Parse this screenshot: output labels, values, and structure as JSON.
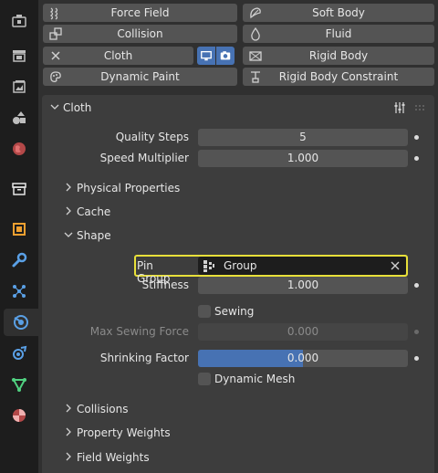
{
  "tabs": [
    {
      "name": "tool-icon",
      "color": "#bdbdbd"
    },
    {
      "name": "render-icon",
      "color": "#bdbdbd"
    },
    {
      "name": "output-icon",
      "color": "#bdbdbd"
    },
    {
      "name": "view-layer-icon",
      "color": "#bdbdbd"
    },
    {
      "name": "scene-icon",
      "color": "#bdbdbd"
    },
    {
      "name": "world-icon",
      "color": "#e06666"
    },
    {
      "name": "collection-icon",
      "color": "#e6e6e6"
    },
    {
      "name": "object-icon",
      "color": "#f0a030"
    },
    {
      "name": "modifier-icon",
      "color": "#5aa0e6"
    },
    {
      "name": "particles-icon",
      "color": "#5aa0e6"
    },
    {
      "name": "physics-icon",
      "color": "#5aa0e6",
      "active": true
    },
    {
      "name": "constraints-icon",
      "color": "#5aa0e6"
    },
    {
      "name": "data-icon",
      "color": "#50d080"
    },
    {
      "name": "material-icon",
      "color": "#e06666"
    }
  ],
  "physics_buttons": {
    "force_field": "Force Field",
    "soft_body": "Soft Body",
    "collision": "Collision",
    "fluid": "Fluid",
    "cloth": "Cloth",
    "rigid_body": "Rigid Body",
    "dynamic_paint": "Dynamic Paint",
    "rigid_body_constraint": "Rigid Body Constraint"
  },
  "cloth_panel": {
    "title": "Cloth",
    "quality_steps": {
      "label": "Quality Steps",
      "value": "5"
    },
    "speed_multiplier": {
      "label": "Speed Multiplier",
      "value": "1.000"
    },
    "subpanels": {
      "physical_properties": "Physical Properties",
      "cache": "Cache",
      "shape": "Shape",
      "collisions": "Collisions",
      "property_weights": "Property Weights",
      "field_weights": "Field Weights"
    },
    "shape": {
      "pin_group": {
        "label": "Pin Group",
        "value": "Group"
      },
      "stiffness": {
        "label": "Stiffness",
        "value": "1.000"
      },
      "sewing": {
        "label": "Sewing",
        "checked": false
      },
      "max_sewing_force": {
        "label": "Max Sewing Force",
        "value": "0.000"
      },
      "shrinking_factor": {
        "label": "Shrinking Factor",
        "value": "0.000"
      },
      "dynamic_mesh": {
        "label": "Dynamic Mesh",
        "checked": false
      }
    }
  },
  "colors": {
    "accent_blue": "#4772b3",
    "highlight_yellow": "#e8e03a"
  }
}
